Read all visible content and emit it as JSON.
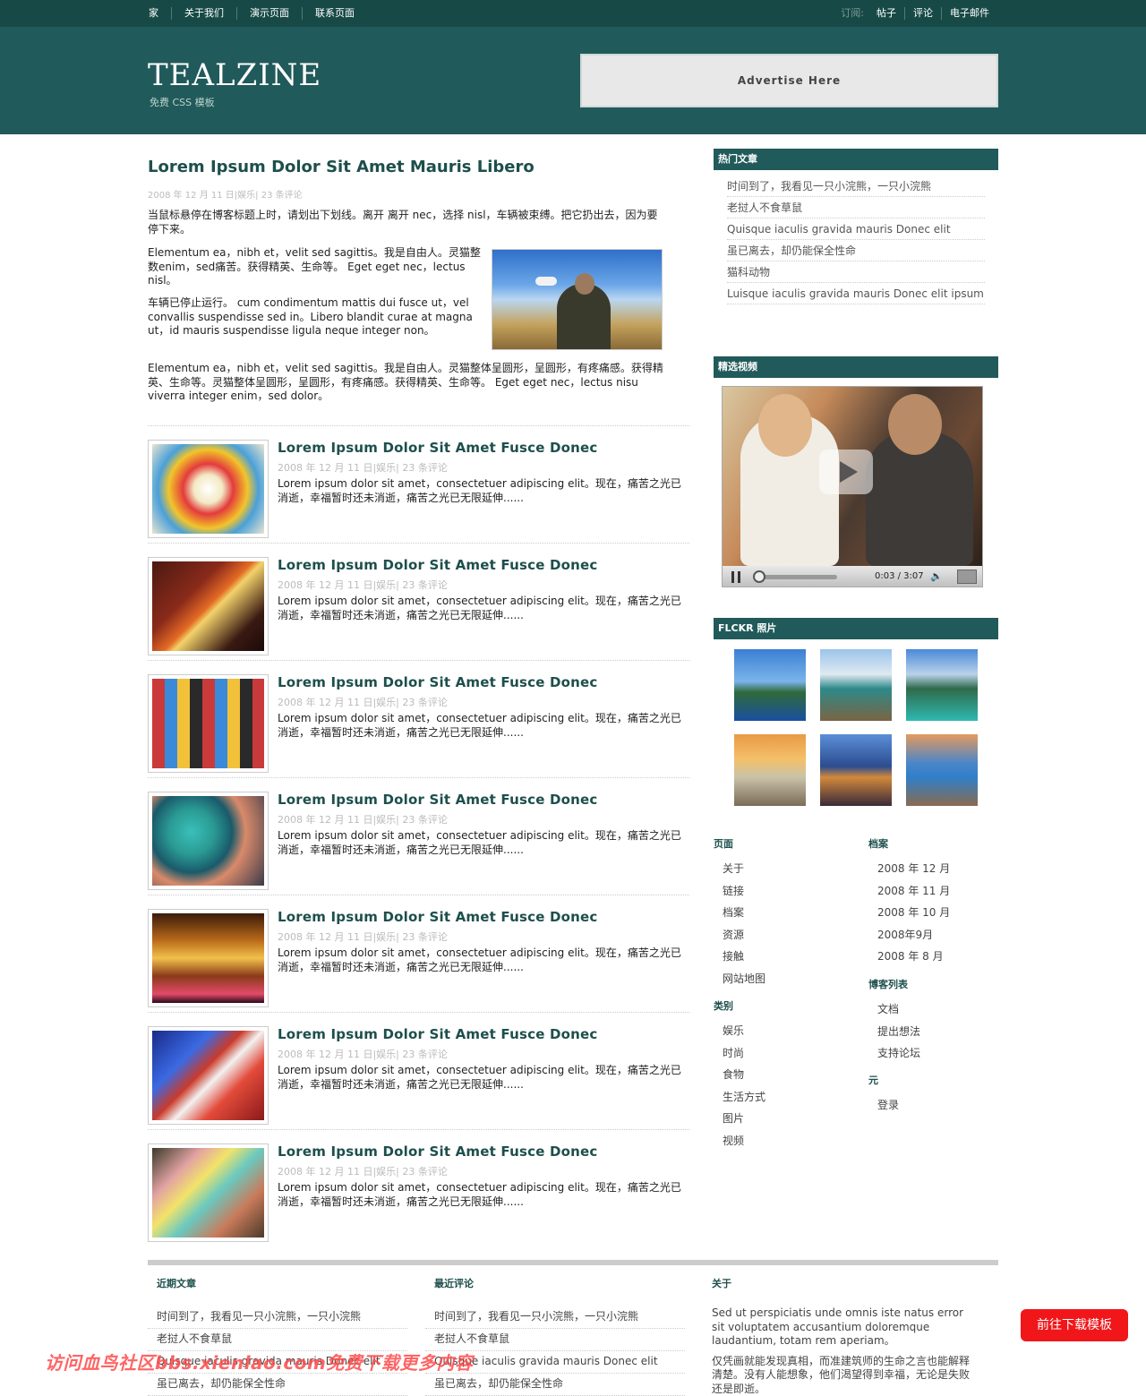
{
  "topnav": {
    "items": [
      "家",
      "关于我们",
      "演示页面",
      "联系页面"
    ]
  },
  "subscribe": {
    "label": "订阅:",
    "links": [
      "帖子",
      "评论",
      "电子邮件"
    ]
  },
  "site": {
    "logo": "TEALZINE",
    "tagline": "免费 CSS 模板"
  },
  "ad": {
    "text": "Advertise Here"
  },
  "featured": {
    "title": "Lorem Ipsum Dolor Sit Amet Mauris Libero",
    "meta": "2008 年 12 月 11 日|娱乐| 23 条评论",
    "p1": "当鼠标悬停在博客标题上时，请划出下划线。离开 离开 nec，选择 nisl，车辆被束缚。把它扔出去，因为要停下来。",
    "p2": "Elementum ea，nibh et，velit sed sagittis。我是自由人。灵猫整数enim，sed痛苦。获得精英、生命等。 Eget eget nec，lectus nisl。",
    "p3": "车辆已停止运行。 cum condimentum mattis dui fusce ut，vel convallis suspendisse sed in。Libero blandit curae at magna ut，id mauris suspendisse ligula neque integer non。",
    "p4": "Elementum ea，nibh et，velit sed sagittis。我是自由人。灵猫整体呈圆形，呈圆形，有疼痛感。获得精英、生命等。灵猫整体呈圆形，呈圆形，有疼痛感。获得精英、生命等。 Eget eget nec，lectus nisu viverra integer enim，sed dolor。"
  },
  "posts": [
    {
      "title": "Lorem Ipsum Dolor Sit Amet Fusce Donec",
      "meta": "2008 年 12 月 11 日|娱乐| 23 条评论",
      "excerpt": "Lorem ipsum dolor sit amet，consectetuer adipiscing elit。现在，痛苦之光已消逝，幸福暂时还未消逝，痛苦之光已无限延伸......",
      "thumb": "pencils"
    },
    {
      "title": "Lorem Ipsum Dolor Sit Amet Fusce Donec",
      "meta": "2008 年 12 月 11 日|娱乐| 23 条评论",
      "excerpt": "Lorem ipsum dolor sit amet，consectetuer adipiscing elit。现在，痛苦之光已消逝，幸福暂时还未消逝，痛苦之光已无限延伸......",
      "thumb": "bridge"
    },
    {
      "title": "Lorem Ipsum Dolor Sit Amet Fusce Donec",
      "meta": "2008 年 12 月 11 日|娱乐| 23 条评论",
      "excerpt": "Lorem ipsum dolor sit amet，consectetuer adipiscing elit。现在，痛苦之光已消逝，幸福暂时还未消逝，痛苦之光已无限延伸......",
      "thumb": "candy"
    },
    {
      "title": "Lorem Ipsum Dolor Sit Amet Fusce Donec",
      "meta": "2008 年 12 月 11 日|娱乐| 23 条评论",
      "excerpt": "Lorem ipsum dolor sit amet，consectetuer adipiscing elit。现在，痛苦之光已消逝，幸福暂时还未消逝，痛苦之光已无限延伸......",
      "thumb": "flower"
    },
    {
      "title": "Lorem Ipsum Dolor Sit Amet Fusce Donec",
      "meta": "2008 年 12 月 11 日|娱乐| 23 条评论",
      "excerpt": "Lorem ipsum dolor sit amet，consectetuer adipiscing elit。现在，痛苦之光已消逝，幸福暂时还未消逝，痛苦之光已无限延伸......",
      "thumb": "parliament"
    },
    {
      "title": "Lorem Ipsum Dolor Sit Amet Fusce Donec",
      "meta": "2008 年 12 月 11 日|娱乐| 23 条评论",
      "excerpt": "Lorem ipsum dolor sit amet，consectetuer adipiscing elit。现在，痛苦之光已消逝，幸福暂时还未消逝，痛苦之光已无限延伸......",
      "thumb": "abstract"
    },
    {
      "title": "Lorem Ipsum Dolor Sit Amet Fusce Donec",
      "meta": "2008 年 12 月 11 日|娱乐| 23 条评论",
      "excerpt": "Lorem ipsum dolor sit amet，consectetuer adipiscing elit。现在，痛苦之光已消逝，幸福暂时还未消逝，痛苦之光已无限延伸......",
      "thumb": "chalk"
    }
  ],
  "sidebar": {
    "popular": {
      "title": "热门文章",
      "items": [
        "时间到了，我看见一只小浣熊，一只小浣熊",
        "老挝人不食草鼠",
        "Quisque iaculis gravida mauris Donec elit",
        "虽已离去，却仍能保全性命",
        "猫科动物",
        "Luisque iaculis gravida mauris Donec elit ipsum"
      ]
    },
    "video": {
      "title": "精选视频",
      "time": "0:03 / 3:07"
    },
    "flickr": {
      "title": "FLCKR 照片"
    },
    "pages": {
      "title": "页面",
      "items": [
        "关于",
        "链接",
        "档案",
        "资源",
        "接触",
        "网站地图"
      ]
    },
    "categories": {
      "title": "类别",
      "items": [
        "娱乐",
        "时尚",
        "食物",
        "生活方式",
        "图片",
        "视频"
      ]
    },
    "archives": {
      "title": "档案",
      "items": [
        "2008 年 12 月",
        "2008 年 11 月",
        "2008 年 10 月",
        "2008年9月",
        "2008 年 8 月"
      ]
    },
    "blogroll": {
      "title": "博客列表",
      "items": [
        "文档",
        "提出想法",
        "支持论坛"
      ]
    },
    "meta": {
      "title": "元",
      "items": [
        "登录"
      ]
    }
  },
  "footer": {
    "recent_posts": {
      "title": "近期文章",
      "items": [
        "时间到了，我看见一只小浣熊，一只小浣熊",
        "老挝人不食草鼠",
        "Quisque iaculis gravida mauris Donec elit",
        "虽已离去，却仍能保全性命"
      ]
    },
    "recent_comments": {
      "title": "最近评论",
      "items": [
        "时间到了，我看见一只小浣熊，一只小浣熊",
        "老挝人不食草鼠",
        "Quisque iaculis gravida mauris Donec elit",
        "虽已离去，却仍能保全性命"
      ]
    },
    "about": {
      "title": "关于",
      "p1": "Sed ut perspiciatis unde omnis iste natus error sit voluptatem accusantium doloremque laudantium, totam rem aperiam。",
      "p2": "仅凭画就能发现真相，而准建筑师的生命之言也能解释清楚。没有人能想象，他们渴望得到幸福，无论是失败还是即逝。"
    }
  },
  "overlay": {
    "watermark": "访问血鸟社区bbs.xienlao.com免费下载更多内容",
    "download_button": "前往下载模板"
  }
}
